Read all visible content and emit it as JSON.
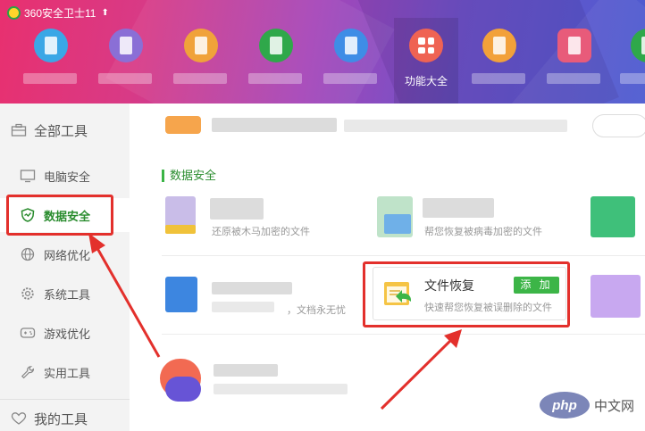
{
  "app": {
    "title": "360安全卫士11"
  },
  "topnav": {
    "active_label": "功能大全"
  },
  "sidebar": {
    "all_tools": "全部工具",
    "items": [
      {
        "label": "电脑安全",
        "icon": "monitor-icon"
      },
      {
        "label": "数据安全",
        "icon": "shield-icon"
      },
      {
        "label": "网络优化",
        "icon": "globe-icon"
      },
      {
        "label": "系统工具",
        "icon": "gear-icon"
      },
      {
        "label": "游戏优化",
        "icon": "gamepad-icon"
      },
      {
        "label": "实用工具",
        "icon": "wrench-icon"
      }
    ],
    "my_tools": "我的工具"
  },
  "main": {
    "section_title": "数据安全",
    "card1_desc": "还原被木马加密的文件",
    "card2_desc": "帮您恢复被病毒加密的文件",
    "card4_desc": "，文档永无忧",
    "recover_card": {
      "title": "文件恢复",
      "add_label": "添 加",
      "desc": "快速帮您恢复被误删除的文件"
    }
  },
  "watermark": {
    "logo": "php",
    "text": "中文网"
  },
  "colors": {
    "accent_green": "#3cb547",
    "annotation_red": "#e3302c"
  }
}
